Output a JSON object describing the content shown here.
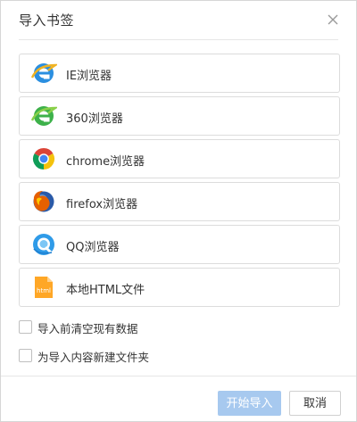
{
  "dialog": {
    "title": "导入书签",
    "close_icon": "close-icon"
  },
  "browsers": [
    {
      "label": "IE浏览器",
      "icon": "ie-icon"
    },
    {
      "label": "360浏览器",
      "icon": "360-browser-icon"
    },
    {
      "label": "chrome浏览器",
      "icon": "chrome-icon"
    },
    {
      "label": "firefox浏览器",
      "icon": "firefox-icon"
    },
    {
      "label": "QQ浏览器",
      "icon": "qq-browser-icon"
    },
    {
      "label": "本地HTML文件",
      "icon": "html-file-icon"
    }
  ],
  "options": {
    "clear_existing": {
      "label": "导入前清空现有数据",
      "checked": false
    },
    "new_folder": {
      "label": "为导入内容新建文件夹",
      "checked": false
    }
  },
  "footer": {
    "start_label": "开始导入",
    "cancel_label": "取消"
  },
  "colors": {
    "primary_disabled": "#a7c9ef",
    "border": "#dcdcdc",
    "text": "#333333"
  }
}
